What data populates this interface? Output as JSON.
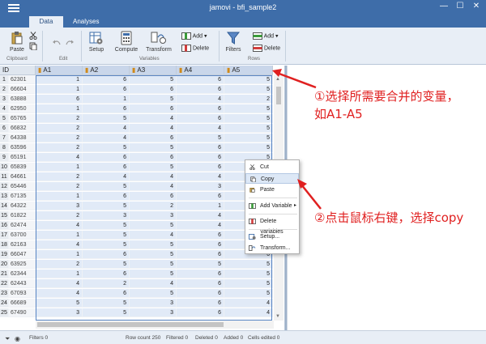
{
  "window": {
    "title": "jamovi - bfi_sample2",
    "minimize": "—",
    "maximize": "☐",
    "close": "✕"
  },
  "tabs": [
    {
      "label": "Data"
    },
    {
      "label": "Analyses"
    }
  ],
  "ribbon": {
    "clipboard": {
      "paste": "Paste",
      "group": "Clipboard"
    },
    "edit": {
      "group": "Edit"
    },
    "variables": {
      "setup": "Setup",
      "compute": "Compute",
      "transform": "Transform",
      "add": "Add",
      "delete": "Delete",
      "group": "Variables"
    },
    "rows": {
      "filters": "Filters",
      "add": "Add",
      "delete": "Delete",
      "group": "Rows"
    }
  },
  "columns": [
    "ID",
    "A1",
    "A2",
    "A3",
    "A4",
    "A5"
  ],
  "rows": [
    [
      "62301",
      "1",
      "6",
      "5",
      "6",
      "5"
    ],
    [
      "66604",
      "1",
      "6",
      "6",
      "6",
      "5"
    ],
    [
      "63888",
      "6",
      "1",
      "5",
      "4",
      "2"
    ],
    [
      "62950",
      "1",
      "6",
      "6",
      "6",
      "5"
    ],
    [
      "65765",
      "2",
      "5",
      "4",
      "6",
      "5"
    ],
    [
      "66832",
      "2",
      "4",
      "4",
      "4",
      "5"
    ],
    [
      "64338",
      "2",
      "4",
      "6",
      "5",
      "5"
    ],
    [
      "63596",
      "2",
      "5",
      "5",
      "6",
      "5"
    ],
    [
      "65191",
      "4",
      "6",
      "6",
      "6",
      "5"
    ],
    [
      "65839",
      "1",
      "6",
      "5",
      "6",
      "5"
    ],
    [
      "64661",
      "2",
      "4",
      "4",
      "4",
      "5"
    ],
    [
      "65446",
      "2",
      "5",
      "4",
      "3",
      "4"
    ],
    [
      "67135",
      "1",
      "6",
      "6",
      "6",
      "5"
    ],
    [
      "64322",
      "3",
      "5",
      "2",
      "1",
      "5"
    ],
    [
      "61822",
      "2",
      "3",
      "3",
      "4",
      "4"
    ],
    [
      "62474",
      "4",
      "5",
      "5",
      "4",
      "5"
    ],
    [
      "63700",
      "1",
      "5",
      "4",
      "6",
      "5"
    ],
    [
      "62163",
      "4",
      "5",
      "5",
      "6",
      "4"
    ],
    [
      "66047",
      "1",
      "6",
      "5",
      "6",
      "6"
    ],
    [
      "63925",
      "2",
      "5",
      "5",
      "5",
      "5"
    ],
    [
      "62344",
      "1",
      "6",
      "5",
      "6",
      "5"
    ],
    [
      "62443",
      "4",
      "2",
      "4",
      "6",
      "5"
    ],
    [
      "67093",
      "4",
      "6",
      "5",
      "6",
      "5"
    ],
    [
      "66689",
      "5",
      "5",
      "3",
      "6",
      "4"
    ],
    [
      "67490",
      "3",
      "5",
      "3",
      "6",
      "4"
    ]
  ],
  "context_menu": {
    "cut": "Cut",
    "copy": "Copy",
    "paste": "Paste",
    "add_variable": "Add Variable",
    "delete_variables": "Delete Variables",
    "setup": "Setup...",
    "transform": "Transform..."
  },
  "status": {
    "filters": "Filters 0",
    "row_count": "Row count 250",
    "filtered": "Filtered 0",
    "deleted": "Deleted 0",
    "added": "Added 0",
    "cells_edited": "Cells edited 0"
  },
  "annotations": {
    "step1_line1": "①选择所需要合并的变量，",
    "step1_line2": "如A1-A5",
    "step2": "②点击鼠标右键，选择copy"
  },
  "colors": {
    "titlebar": "#3e6da9",
    "selection": "#e1eaf7",
    "annotation": "#e02020"
  }
}
